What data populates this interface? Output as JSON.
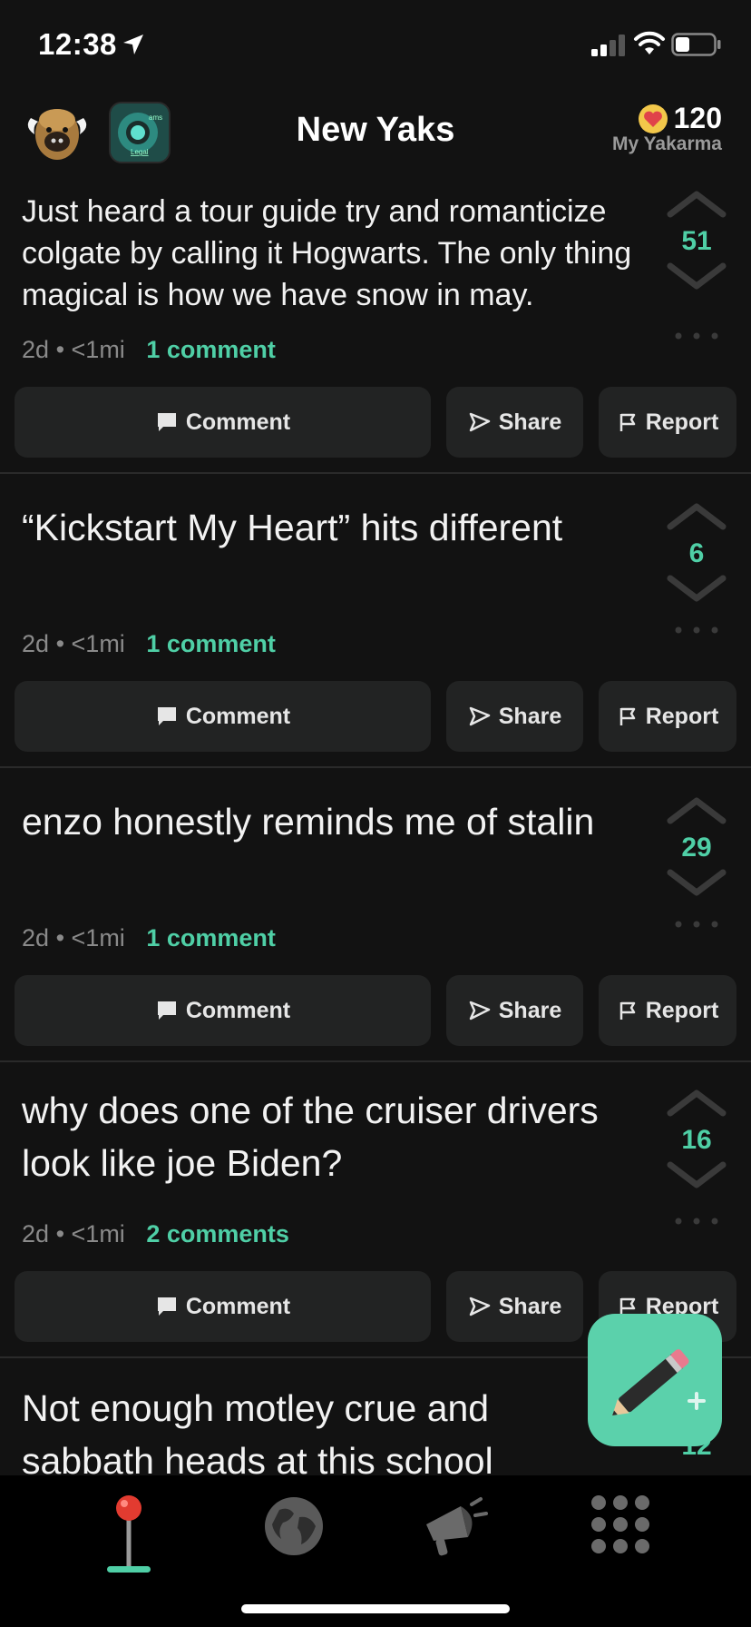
{
  "status_bar": {
    "time": "12:38"
  },
  "header": {
    "title": "New Yaks",
    "karma_value": "120",
    "karma_label": "My Yakarma",
    "school_logo_text_top": "ams",
    "school_logo_text_bottom": "Legal"
  },
  "posts": [
    {
      "text": "Just heard a tour guide try and romanticize colgate by calling it Hogwarts. The only thing magical is how we have snow in may.",
      "age": "2d",
      "distance": "<1mi",
      "comments": "1 comment",
      "votes": "51"
    },
    {
      "text": "“Kickstart My Heart” hits different",
      "age": "2d",
      "distance": "<1mi",
      "comments": "1 comment",
      "votes": "6"
    },
    {
      "text": "enzo honestly reminds me of stalin",
      "age": "2d",
      "distance": "<1mi",
      "comments": "1 comment",
      "votes": "29"
    },
    {
      "text": "why does one of the cruiser drivers look like joe Biden?",
      "age": "2d",
      "distance": "<1mi",
      "comments": "2 comments",
      "votes": "16"
    },
    {
      "text": "Not enough motley crue and sabbath heads at this school",
      "votes": "12"
    }
  ],
  "actions": {
    "comment": "Comment",
    "share": "Share",
    "report": "Report"
  },
  "meta_separator": "•",
  "colors": {
    "accent": "#4fcfa6",
    "background": "#121212",
    "button": "#222323",
    "fab": "#5bd1ab"
  },
  "tabs": [
    {
      "icon": "pin-icon",
      "selected": true
    },
    {
      "icon": "globe-icon"
    },
    {
      "icon": "megaphone-icon"
    },
    {
      "icon": "grid-icon"
    }
  ],
  "fab": {
    "icon": "pencil-plus-icon"
  }
}
